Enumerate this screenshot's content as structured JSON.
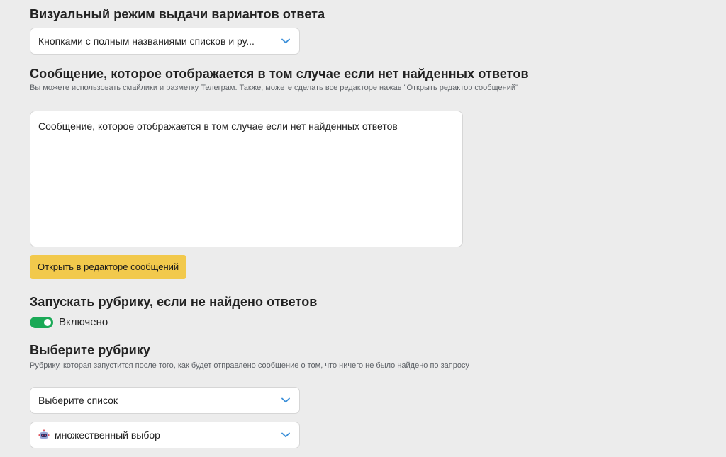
{
  "display_mode": {
    "title": "Визуальный режим выдачи вариантов ответа",
    "selected": "Кнопками с полным названиями списков и ру..."
  },
  "no_answer_message": {
    "title": "Сообщение, которое отображается в том случае если нет найденных ответов",
    "hint": "Вы можете использовать смайлики и разметку Телеграм. Также, можете сделать все редакторе нажав \"Открыть редактор сообщений\"",
    "value": "Сообщение, которое отображается в том случае если нет найденных ответов",
    "open_editor_label": "Открыть в редакторе сообщений"
  },
  "run_rubric": {
    "title": "Запускать рубрику, если не найдено ответов",
    "toggle_label": "Включено",
    "enabled": true
  },
  "choose_rubric": {
    "title": "Выберите рубрику",
    "hint": "Рубрику, которая запустится после того, как будет отправлено сообщение о том, что ничего не было найдено по запросу",
    "list_selected": "Выберите список",
    "rubric_selected": "множественный выбор"
  },
  "colors": {
    "accent_button": "#f2c94c",
    "toggle_on": "#1aa956",
    "chevron": "#3b8fd9"
  },
  "icons": {
    "chevron": "chevron-down-icon",
    "rubric": "robot-icon"
  }
}
